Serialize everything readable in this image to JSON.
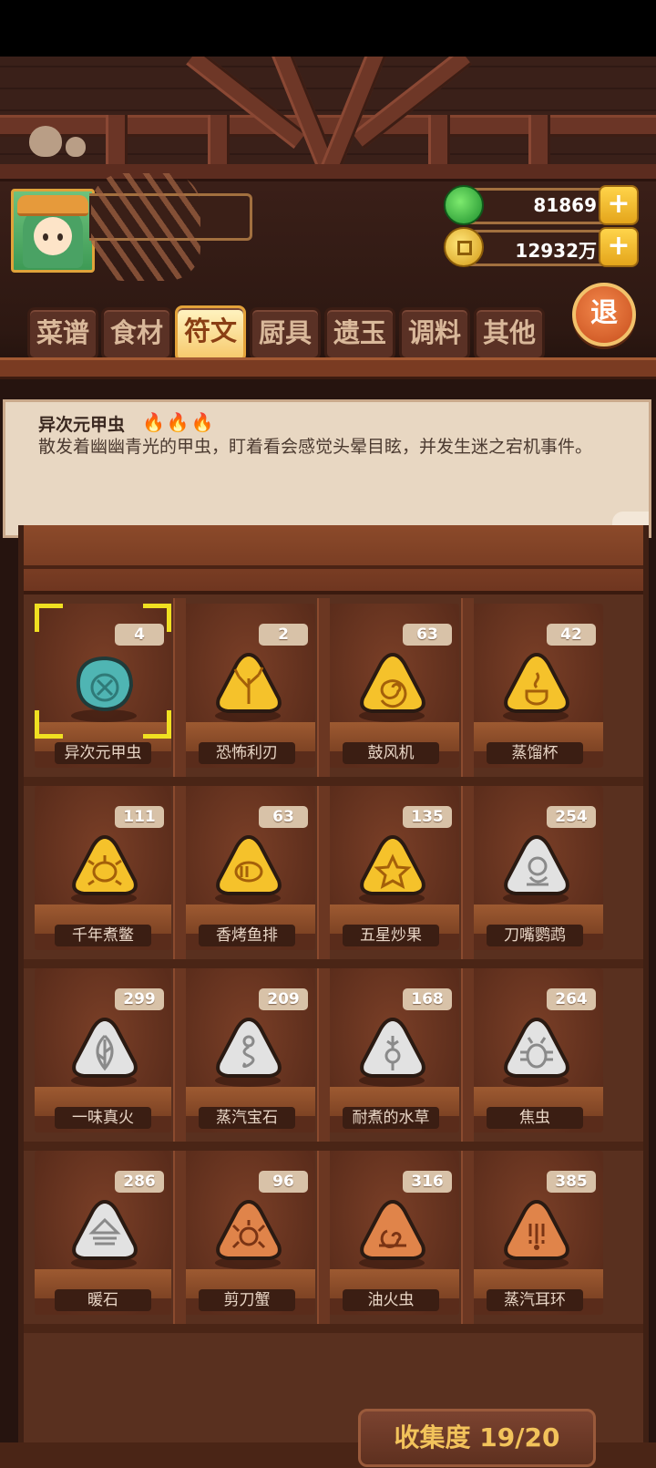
{
  "header": {
    "currencies": [
      {
        "icon": "jade-gem-icon",
        "value": "81869"
      },
      {
        "icon": "copper-coin-icon",
        "value": "12932万"
      }
    ],
    "exit_label": "退"
  },
  "tabs": [
    {
      "label": "菜谱",
      "active": false
    },
    {
      "label": "食材",
      "active": false
    },
    {
      "label": "符文",
      "active": true
    },
    {
      "label": "厨具",
      "active": false
    },
    {
      "label": "遗玉",
      "active": false
    },
    {
      "label": "调料",
      "active": false
    },
    {
      "label": "其他",
      "active": false
    }
  ],
  "selected": {
    "name": "异次元甲虫",
    "flames": "🔥🔥🔥",
    "description": "散发着幽幽青光的甲虫，盯着看会感觉头晕目眩，并发生迷之宕机事件。"
  },
  "items": [
    {
      "name": "异次元甲虫",
      "count": "4",
      "color": "#4fb5b3",
      "shape": "round",
      "glyph": "beetle"
    },
    {
      "name": "恐怖利刃",
      "count": "2",
      "color": "#f5c22b",
      "shape": "triangle",
      "glyph": "antler"
    },
    {
      "name": "鼓风机",
      "count": "63",
      "color": "#f5c22b",
      "shape": "triangle",
      "glyph": "spiral"
    },
    {
      "name": "蒸馏杯",
      "count": "42",
      "color": "#f5c22b",
      "shape": "triangle",
      "glyph": "cup"
    },
    {
      "name": "千年煮鳖",
      "count": "111",
      "color": "#f5c22b",
      "shape": "triangle",
      "glyph": "turtle"
    },
    {
      "name": "香烤鱼排",
      "count": "63",
      "color": "#f5c22b",
      "shape": "triangle",
      "glyph": "fish"
    },
    {
      "name": "五星炒果",
      "count": "135",
      "color": "#f5c22b",
      "shape": "triangle",
      "glyph": "star"
    },
    {
      "name": "刀嘴鹦鹉",
      "count": "254",
      "color": "#e2e2e2",
      "shape": "triangle",
      "glyph": "parrot"
    },
    {
      "name": "一味真火",
      "count": "299",
      "color": "#e2e2e2",
      "shape": "triangle",
      "glyph": "leaf"
    },
    {
      "name": "蒸汽宝石",
      "count": "209",
      "color": "#e2e2e2",
      "shape": "triangle",
      "glyph": "swirl"
    },
    {
      "name": "耐煮的水草",
      "count": "168",
      "color": "#e2e2e2",
      "shape": "triangle",
      "glyph": "weed"
    },
    {
      "name": "焦虫",
      "count": "264",
      "color": "#e2e2e2",
      "shape": "triangle",
      "glyph": "bug"
    },
    {
      "name": "暖石",
      "count": "286",
      "color": "#e2e2e2",
      "shape": "triangle",
      "glyph": "stone"
    },
    {
      "name": "剪刀蟹",
      "count": "96",
      "color": "#e0844a",
      "shape": "triangle",
      "glyph": "crab"
    },
    {
      "name": "油火虫",
      "count": "316",
      "color": "#e0844a",
      "shape": "triangle",
      "glyph": "snail"
    },
    {
      "name": "蒸汽耳环",
      "count": "385",
      "color": "#e0844a",
      "shape": "triangle",
      "glyph": "earring"
    }
  ],
  "collection_label": "收集度 19/20"
}
